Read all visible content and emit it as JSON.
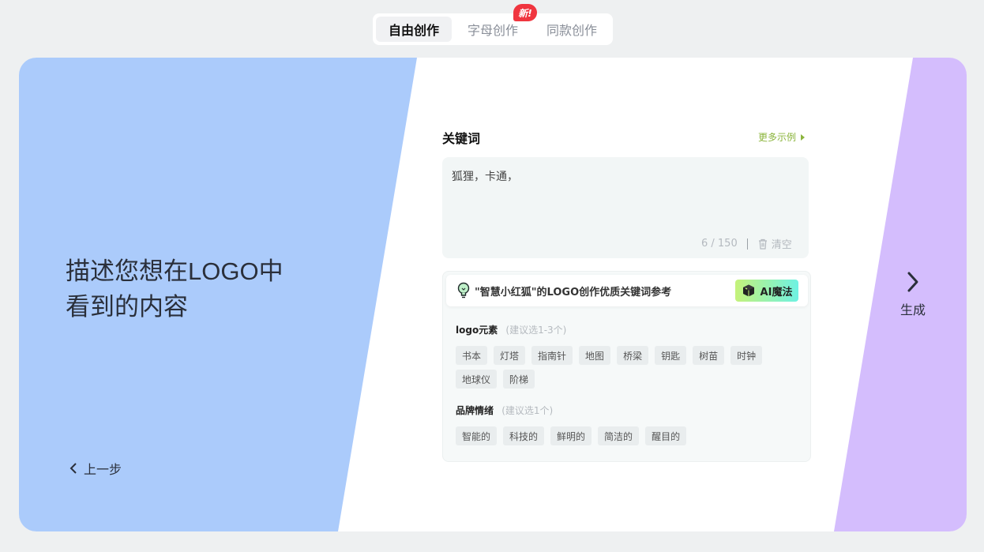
{
  "tabs": [
    {
      "label": "自由创作",
      "active": true
    },
    {
      "label": "字母创作",
      "active": false
    },
    {
      "label": "同款创作",
      "active": false
    }
  ],
  "new_badge": "新!",
  "left": {
    "heading_line1": "描述您想在LOGO中",
    "heading_line2": "看到的内容",
    "back_label": "上一步"
  },
  "right": {
    "generate_label": "生成"
  },
  "keywords": {
    "title": "关键词",
    "more_link": "更多示例",
    "value": "狐狸，卡通，",
    "count": "6 / 150",
    "clear_label": "清空"
  },
  "reference": {
    "title": "\"智慧小红狐\"的LOGO创作优质关键词参考",
    "ai_button": "AI魔法",
    "groups": [
      {
        "label": "logo元素",
        "hint": "(建议选1-3个)",
        "chips": [
          "书本",
          "灯塔",
          "指南针",
          "地图",
          "桥梁",
          "钥匙",
          "树苗",
          "时钟",
          "地球仪",
          "阶梯"
        ]
      },
      {
        "label": "品牌情绪",
        "hint": "(建议选1个)",
        "chips": [
          "智能的",
          "科技的",
          "鲜明的",
          "简洁的",
          "醒目的"
        ]
      }
    ]
  },
  "colors": {
    "left_panel": "#abcbfb",
    "right_panel": "#d4bdfd",
    "accent_green": "#8bb43c",
    "badge_red": "#f0353f"
  }
}
